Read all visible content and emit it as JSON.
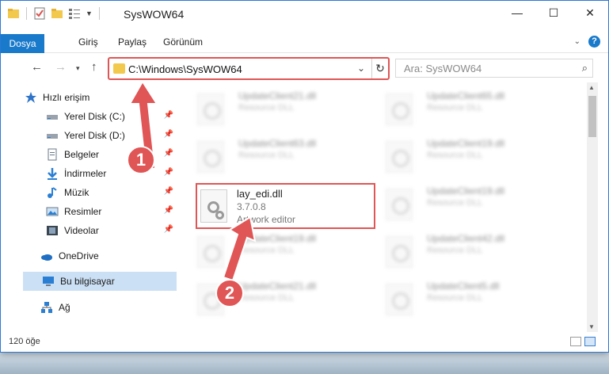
{
  "window": {
    "title": "SysWOW64"
  },
  "ribbon": {
    "tabs": [
      "Dosya",
      "Giriş",
      "Paylaş",
      "Görünüm"
    ]
  },
  "address": {
    "path": "C:\\Windows\\SysWOW64",
    "search_placeholder": "Ara: SysWOW64"
  },
  "nav": {
    "quick_access": "Hızlı erişim",
    "items": [
      {
        "label": "Yerel Disk (C:)",
        "icon": "drive-icon",
        "pinned": true
      },
      {
        "label": "Yerel Disk (D:)",
        "icon": "drive-icon",
        "pinned": true
      },
      {
        "label": "Belgeler",
        "icon": "documents-icon",
        "pinned": true
      },
      {
        "label": "İndirmeler",
        "icon": "downloads-icon",
        "pinned": true
      },
      {
        "label": "Müzik",
        "icon": "music-icon",
        "pinned": true
      },
      {
        "label": "Resimler",
        "icon": "pictures-icon",
        "pinned": true
      },
      {
        "label": "Videolar",
        "icon": "videos-icon",
        "pinned": true
      }
    ],
    "onedrive": "OneDrive",
    "this_pc": "Bu bilgisayar",
    "network": "Ağ"
  },
  "files": {
    "left_column": [
      {
        "name": "UpdateClient21.dll",
        "desc": "Resource DLL"
      },
      {
        "name": "UpdateClient63.dll",
        "desc": "Resource DLL"
      },
      {
        "name": "UpdateClient19.dll",
        "desc": "Resource DLL"
      },
      {
        "name": "UpdateClient21.dll",
        "desc": "Resource DLL"
      }
    ],
    "right_column": [
      {
        "name": "UpdateClient65.dll",
        "desc": "Resource DLL"
      },
      {
        "name": "UpdateClient19.dll",
        "desc": "Resource DLL"
      },
      {
        "name": "UpdateClient19.dll",
        "desc": "Resource DLL"
      },
      {
        "name": "UpdateClient42.dll",
        "desc": "Resource DLL"
      },
      {
        "name": "UpdateClient5.dll",
        "desc": "Resource DLL"
      }
    ],
    "highlighted": {
      "name": "lay_edi.dll",
      "version": "3.7.0.8",
      "desc": "Artwork editor"
    }
  },
  "status": {
    "count": "120 öğe"
  },
  "annotations": {
    "step1": "1",
    "step2": "2",
    "color": "#e05555"
  }
}
